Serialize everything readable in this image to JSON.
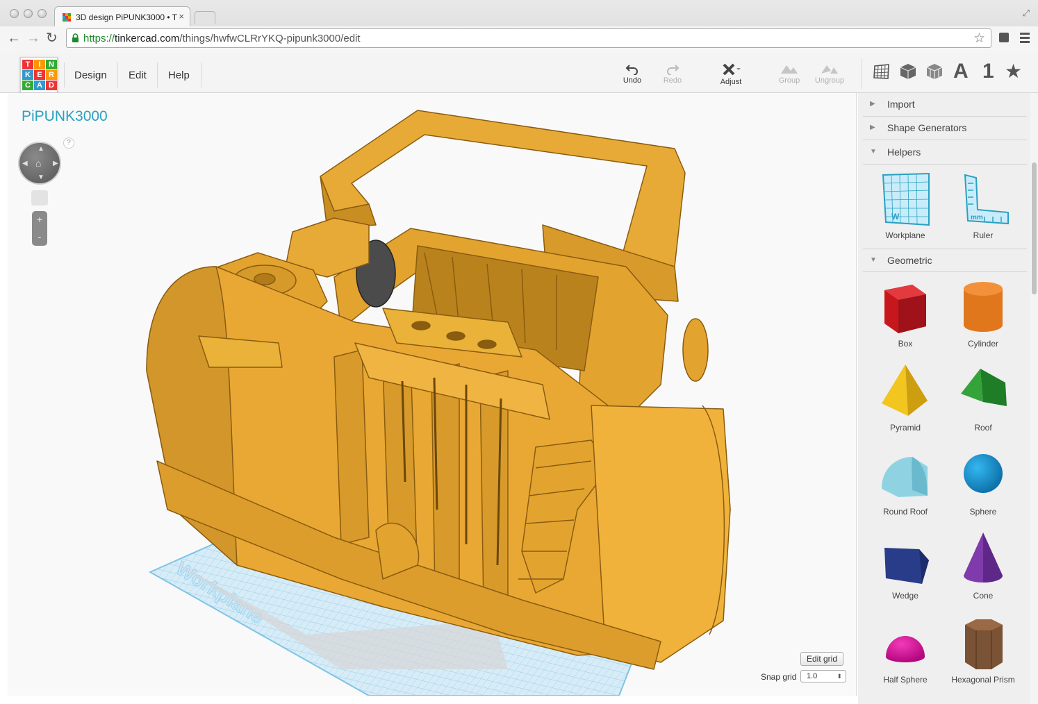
{
  "browser": {
    "tab_title": "3D design PiPUNK3000 • T",
    "tab_close": "×",
    "url_scheme": "https://",
    "url_host": "tinkercad.com",
    "url_path": "/things/hwfwCLRrYKQ-pipunk3000/edit",
    "back": "←",
    "forward": "→",
    "reload": "↻",
    "bookmark_star": "☆",
    "fullscreen": "⤢"
  },
  "header": {
    "logo_letters": [
      "T",
      "I",
      "N",
      "K",
      "E",
      "R",
      "C",
      "A",
      "D"
    ],
    "menu": [
      "Design",
      "Edit",
      "Help"
    ],
    "tools": {
      "undo": "Undo",
      "redo": "Redo",
      "adjust": "Adjust",
      "group": "Group",
      "ungroup": "Ungroup"
    },
    "view_letter_a": "A",
    "view_number": "1",
    "view_star": "★"
  },
  "canvas": {
    "design_title": "PiPUNK3000",
    "help": "?",
    "zoom_in": "+",
    "zoom_out": "-",
    "workplane_label": "Workplane",
    "edit_grid": "Edit grid",
    "snap_grid_label": "Snap grid",
    "snap_grid_value": "1.0",
    "snap_grid_arrows": "⬍"
  },
  "panel": {
    "sections": {
      "import": "Import",
      "shape_generators": "Shape Generators",
      "helpers": "Helpers",
      "geometric": "Geometric"
    },
    "helpers": [
      "Workplane",
      "Ruler"
    ],
    "shapes": [
      "Box",
      "Cylinder",
      "Pyramid",
      "Roof",
      "Round Roof",
      "Sphere",
      "Wedge",
      "Cone",
      "Half Sphere",
      "Hexagonal Prism"
    ]
  },
  "colors": {
    "accent": "#2aa1c0",
    "model": "#e6a533",
    "model_dark": "#b77e1e",
    "grid": "#9fd3ee"
  }
}
